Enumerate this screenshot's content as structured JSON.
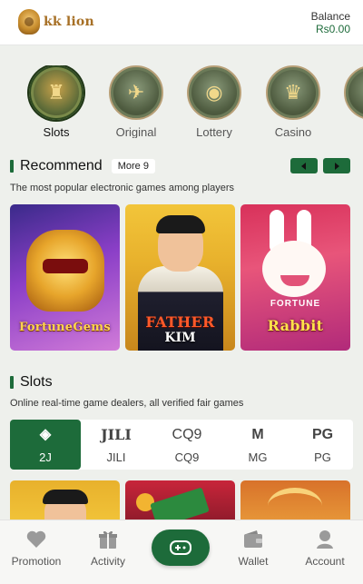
{
  "header": {
    "logo_text": "kk lion",
    "balance_label": "Balance",
    "balance_value": "Rs0.00"
  },
  "categories": [
    {
      "label": "Slots",
      "icon": "slots-icon",
      "active": true
    },
    {
      "label": "Original",
      "icon": "original-icon",
      "active": false
    },
    {
      "label": "Lottery",
      "icon": "lottery-icon",
      "active": false
    },
    {
      "label": "Casino",
      "icon": "casino-icon",
      "active": false
    }
  ],
  "recommend": {
    "title": "Recommend",
    "more_label": "More 9",
    "subtitle": "The most popular electronic games among players",
    "games": [
      {
        "title": "FortuneGems"
      },
      {
        "title": "FATHER",
        "title2": "KIM"
      },
      {
        "title": "Rabbit",
        "title_top": "FORTUNE"
      }
    ]
  },
  "slots": {
    "title": "Slots",
    "subtitle": "Online real-time game dealers, all verified fair games",
    "providers": [
      {
        "logo": "◈",
        "name": "2J",
        "active": true
      },
      {
        "logo": "JILI",
        "name": "JILI",
        "active": false
      },
      {
        "logo": "CQ9",
        "name": "CQ9",
        "active": false
      },
      {
        "logo": "M",
        "name": "MG",
        "active": false
      },
      {
        "logo": "PG",
        "name": "PG",
        "active": false
      }
    ]
  },
  "nav": {
    "items": [
      {
        "label": "Promotion",
        "icon": "promotion-icon"
      },
      {
        "label": "Activity",
        "icon": "gift-icon"
      },
      {
        "label": "Wallet",
        "icon": "wallet-icon"
      },
      {
        "label": "Account",
        "icon": "account-icon"
      }
    ],
    "center_icon": "gamepad-icon"
  },
  "colors": {
    "accent": "#1d6b3a",
    "background": "#eef0ec"
  }
}
